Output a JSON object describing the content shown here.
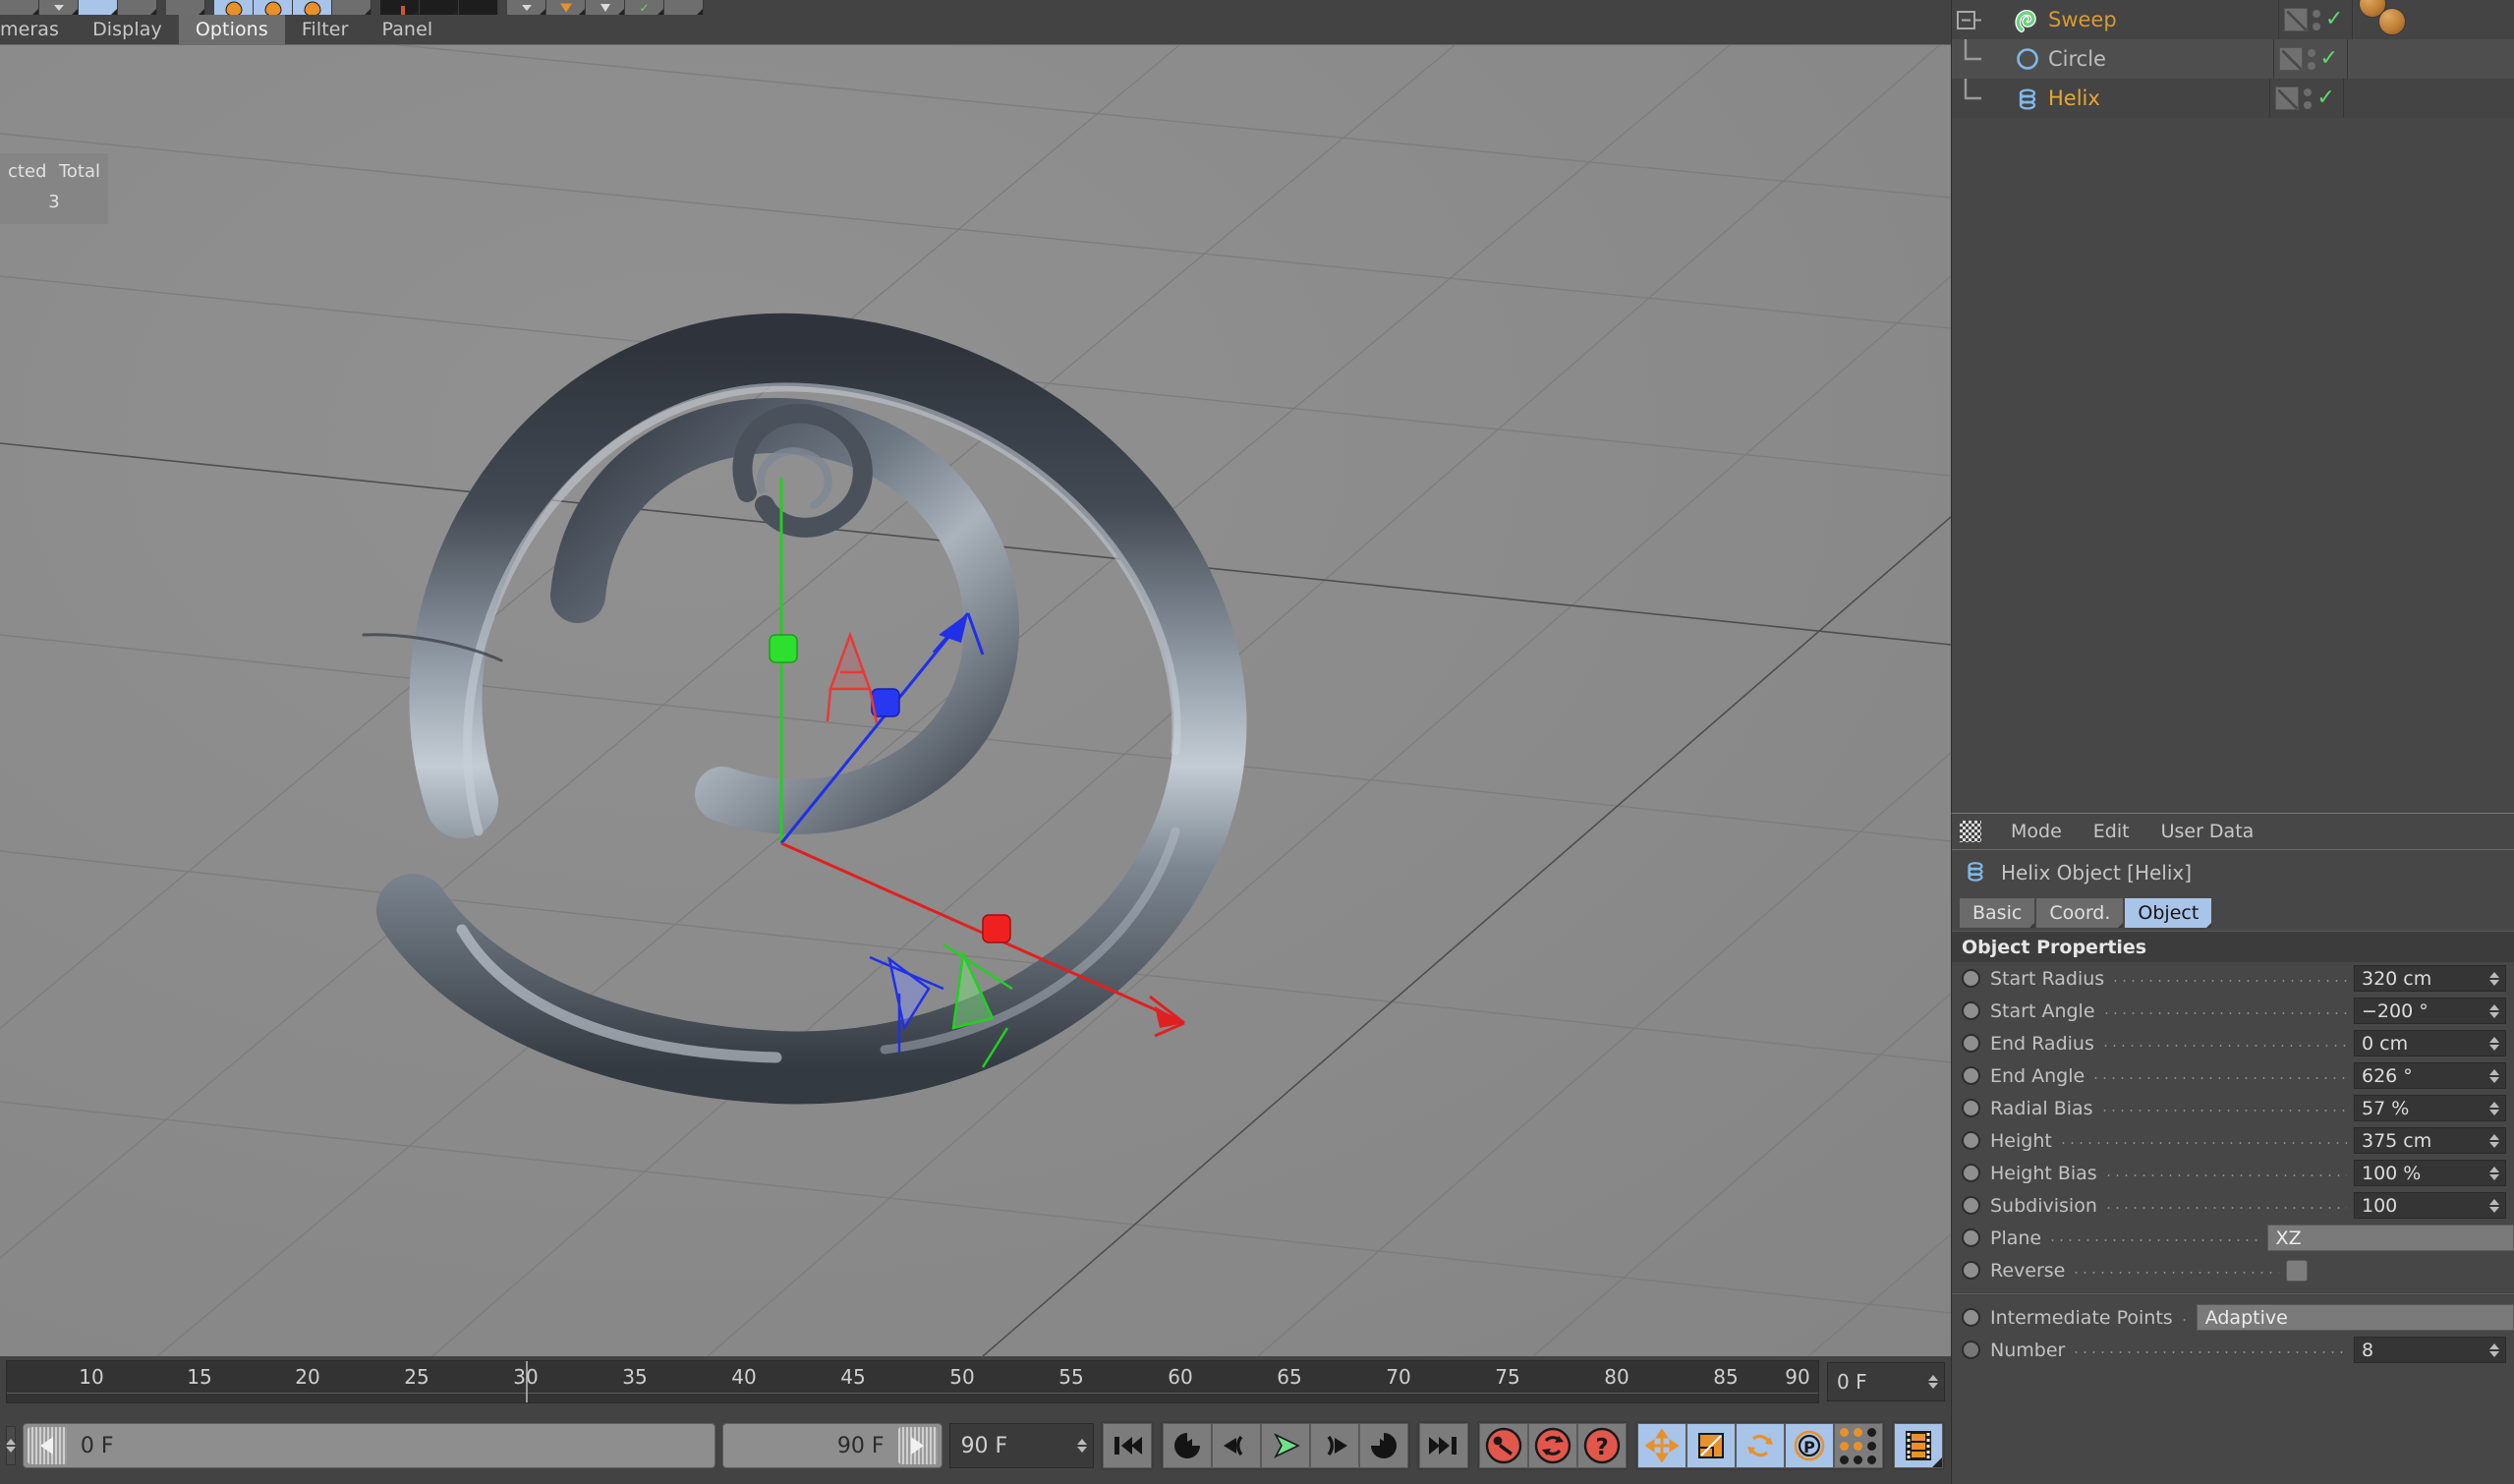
{
  "app": {
    "name": "Cinema 4D",
    "accent_blue": "#a8c4e8",
    "accent_orange": "#e8912a",
    "accent_green": "#5fd96a",
    "panel_bg": "#474747",
    "viewport_bg": "#8a8a8a"
  },
  "viewport_menu": {
    "items": [
      {
        "label": "meras",
        "active": false
      },
      {
        "label": "Display",
        "active": false
      },
      {
        "label": "Options",
        "active": true
      },
      {
        "label": "Filter",
        "active": false
      },
      {
        "label": "Panel",
        "active": false
      }
    ],
    "corner_icons": [
      "move-axis-icon",
      "scale-axis-icon",
      "rotate-axis-icon",
      "maximize-view-icon"
    ]
  },
  "viewport_hud": {
    "label_left": "cted",
    "label_right": "Total",
    "value": "3"
  },
  "scene": {
    "object_name": "Helix Sweep",
    "gizmo": {
      "x_axis_color": "#e02020",
      "y_axis_color": "#22d022",
      "z_axis_color": "#2030e8",
      "label": "A"
    }
  },
  "object_manager": {
    "rows": [
      {
        "name": "Sweep",
        "icon": "sweep-nurbs-icon",
        "color_class": "sweep",
        "depth": 0,
        "expanded": true,
        "visible_check": "✓",
        "has_material": true
      },
      {
        "name": "Circle",
        "icon": "circle-spline-icon",
        "color_class": "circle",
        "depth": 1,
        "expanded": false,
        "visible_check": "✓",
        "has_material": false
      },
      {
        "name": "Helix",
        "icon": "helix-spline-icon",
        "color_class": "helix",
        "depth": 1,
        "expanded": false,
        "visible_check": "✓",
        "has_material": false
      }
    ]
  },
  "attribute_manager": {
    "menu": [
      "Mode",
      "Edit",
      "User Data"
    ],
    "title": "Helix Object [Helix]",
    "title_icon": "helix-spline-icon",
    "tabs": [
      {
        "label": "Basic",
        "active": false
      },
      {
        "label": "Coord.",
        "active": false
      },
      {
        "label": "Object",
        "active": true
      }
    ],
    "section_title": "Object Properties",
    "properties": [
      {
        "label": "Start Radius",
        "value": "320 cm",
        "type": "number"
      },
      {
        "label": "Start Angle",
        "value": "−200 °",
        "type": "number"
      },
      {
        "label": "End Radius",
        "value": "0 cm",
        "type": "number"
      },
      {
        "label": "End Angle",
        "value": "626 °",
        "type": "number"
      },
      {
        "label": "Radial Bias",
        "value": "57 %",
        "type": "number"
      },
      {
        "label": "Height",
        "value": "375 cm",
        "type": "number"
      },
      {
        "label": "Height Bias",
        "value": "100 %",
        "type": "number"
      },
      {
        "label": "Subdivision",
        "value": "100",
        "type": "number"
      },
      {
        "label": "Plane",
        "value": "XZ",
        "type": "dropdown"
      },
      {
        "label": "Reverse",
        "value": "",
        "type": "checkbox",
        "checked": false
      }
    ],
    "properties_after_divider": [
      {
        "label": "Intermediate Points",
        "value": "Adaptive",
        "type": "dropdown"
      },
      {
        "label": "Number",
        "value": "8",
        "type": "number"
      }
    ]
  },
  "timeline": {
    "ticks": [
      "10",
      "15",
      "20",
      "25",
      "30",
      "35",
      "40",
      "45",
      "50",
      "55",
      "60",
      "65",
      "70",
      "75",
      "80",
      "85",
      "90"
    ],
    "tick_start_frame": 10,
    "tick_step": 5,
    "range_start": 0,
    "range_end": 90,
    "playhead_frame": 30,
    "current_frame_field": "0 F"
  },
  "bottom_bar": {
    "range_start_label": "0 F",
    "range_end_label": "90 F",
    "end_frame_field": "90 F",
    "transport": [
      {
        "name": "go-to-start-button",
        "icon": "skip-back-icon"
      },
      {
        "name": "previous-keyframe-button",
        "icon": "prev-key-icon"
      },
      {
        "name": "step-back-button",
        "icon": "step-back-icon"
      },
      {
        "name": "play-button",
        "icon": "play-icon",
        "highlight": "#6fe08a"
      },
      {
        "name": "step-forward-button",
        "icon": "step-forward-icon"
      },
      {
        "name": "next-keyframe-button",
        "icon": "next-key-icon"
      },
      {
        "name": "go-to-end-button",
        "icon": "skip-forward-icon"
      }
    ],
    "record_group": [
      {
        "name": "record-keyframe-button",
        "icon": "key-icon",
        "color": "#e2574c"
      },
      {
        "name": "autokeying-button",
        "icon": "autokey-icon",
        "color": "#e2574c"
      },
      {
        "name": "keyframe-selection-button",
        "icon": "question-icon",
        "color": "#e2574c"
      }
    ],
    "anim_group": [
      {
        "name": "record-position-button",
        "icon": "move-arrows-icon",
        "active": true
      },
      {
        "name": "record-scale-button",
        "icon": "scale-icon",
        "active": true
      },
      {
        "name": "record-rotation-button",
        "icon": "rotate-icon",
        "active": true
      },
      {
        "name": "record-pla-button",
        "icon": "pla-icon",
        "active": true
      },
      {
        "name": "point-level-animation-button",
        "icon": "dot-grid-icon",
        "active": false
      }
    ],
    "timeline_toggle": {
      "name": "timeline-button",
      "icon": "film-strip-icon",
      "active": true
    }
  }
}
